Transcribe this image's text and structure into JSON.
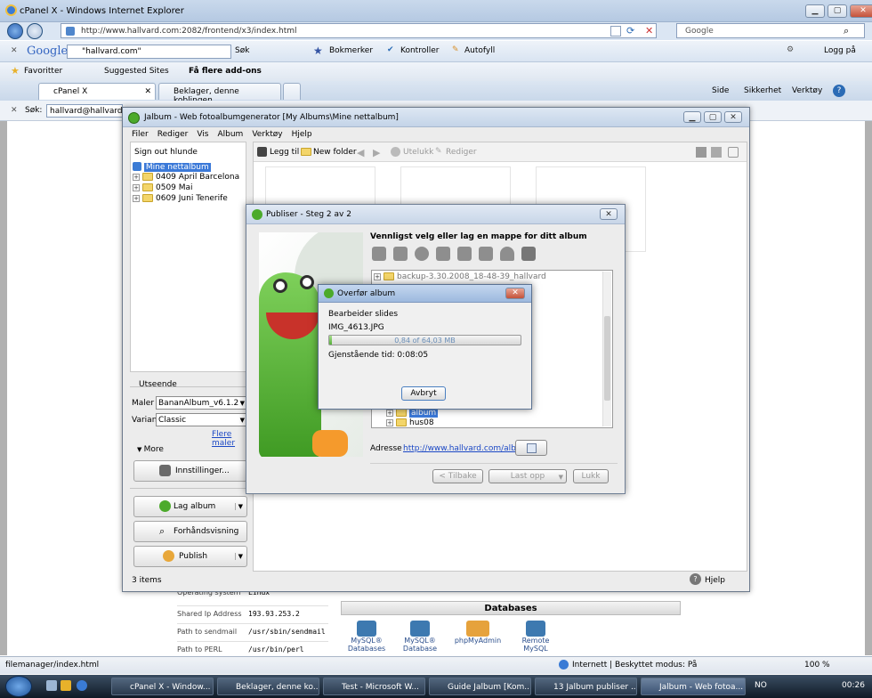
{
  "ie": {
    "title": "cPanel X - Windows Internet Explorer",
    "address": "http://www.hallvard.com:2082/frontend/x3/index.html",
    "search_placeholder": "Google",
    "google_logo": "Google",
    "google_query": "\"hallvard.com\"",
    "google_search_btn": "Søk",
    "bookmarks_btn": "Bokmerker",
    "checks_btn": "Kontroller",
    "autofill_btn": "Autofyll",
    "login_btn": "Logg på",
    "favorites_label": "Favoritter",
    "suggested_label": "Suggested Sites",
    "addons_label": "Få flere add-ons",
    "tabs": [
      "cPanel X",
      "Beklager, denne koblingen..."
    ],
    "tools": [
      "Side",
      "Sikkerhet",
      "Verktøy"
    ],
    "find_label": "Søk:",
    "find_value": "hallvard@hallvard.co"
  },
  "cpanel": {
    "rows": [
      {
        "label": "Operating system",
        "value": "Linux"
      },
      {
        "label": "Shared Ip Address",
        "value": "193.93.253.2"
      },
      {
        "label": "Path to sendmail",
        "value": "/usr/sbin/sendmail"
      },
      {
        "label": "Path to PERL",
        "value": "/usr/bin/perl"
      }
    ],
    "db_header": "Databases",
    "db_items": [
      "MySQL® Databases",
      "MySQL® Database ...",
      "phpMyAdmin",
      "Remote MySQL"
    ]
  },
  "jalbum": {
    "title": "Jalbum - Web fotoalbumgenerator [My Albums\\Mine nettalbum]",
    "menu": [
      "Filer",
      "Rediger",
      "Vis",
      "Album",
      "Verktøy",
      "Hjelp"
    ],
    "signout": "Sign out hlunde",
    "tree_root": "Mine nettalbum",
    "tree_items": [
      "0409 April Barcelona",
      "0509 Mai",
      "0609 Juni Tenerife"
    ],
    "toolbar": {
      "add": "Legg til",
      "new_folder": "New folder",
      "delete": "Utelukk",
      "edit": "Rediger"
    },
    "look_header": "Utseende",
    "template_label": "Maler",
    "template_value": "BananAlbum_v6.1.2",
    "variant_label": "Variant",
    "variant_value": "Classic",
    "more_templates": "Flere maler",
    "more_label": "More",
    "settings_btn": "Innstillinger...",
    "make_album_btn": "Lag album",
    "preview_btn": "Forhåndsvisning",
    "publish_btn": "Publish",
    "status": "3 items",
    "help": "Hjelp"
  },
  "publish": {
    "title": "Publiser - Steg 2 av 2",
    "heading": "Vennligst velg eller lag en mappe for ditt album",
    "tree_top": "backup-3.30.2008_18-48-39_hallvard",
    "tree_bottom": [
      "album",
      "hus08"
    ],
    "address_label": "Adresse",
    "address_url": "http://www.hallvard.com/album",
    "back_btn": "< Tilbake",
    "upload_btn": "Last opp",
    "close_btn": "Lukk"
  },
  "transfer": {
    "title": "Overfør album",
    "line1": "Bearbeider slides",
    "file": "IMG_4613.JPG",
    "progress_text": "0,84 of 64,03 MB",
    "progress_fraction": 0.013,
    "remaining": "Gjenstående tid: 0:08:05",
    "cancel": "Avbryt"
  },
  "statusbar": {
    "left": "filemanager/index.html",
    "zone": "Internett | Beskyttet modus: På",
    "zoom": "100 %"
  },
  "taskbar": {
    "items": [
      "cPanel X - Window...",
      "Beklager, denne ko...",
      "Test - Microsoft W...",
      "Guide Jalbum [Kom...",
      "13 Jalbum publiser ...",
      "Jalbum - Web fotoa..."
    ],
    "lang": "NO",
    "clock": "00:26"
  }
}
